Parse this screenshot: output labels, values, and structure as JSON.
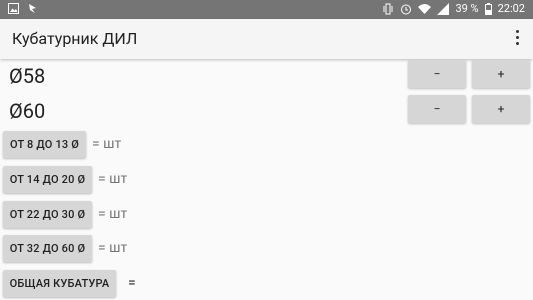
{
  "status_bar": {
    "battery": "39 %",
    "time": "22:02"
  },
  "app_bar": {
    "title": "Кубатурник ДИЛ"
  },
  "rows": [
    {
      "label": "Ø58",
      "minus": "−",
      "plus": "+"
    },
    {
      "label": "Ø60",
      "minus": "−",
      "plus": "+"
    }
  ],
  "categories": [
    {
      "label": "ОТ 8 ДО 13 Ø",
      "result": "= шт"
    },
    {
      "label": "ОТ 14 ДО 20 Ø",
      "result": "= шт"
    },
    {
      "label": "ОТ 22 ДО 30 Ø",
      "result": "= шт"
    },
    {
      "label": "ОТ 32 ДО 60 Ø",
      "result": "= шт"
    }
  ],
  "total": {
    "label": "ОБЩАЯ КУБАТУРА",
    "result": "="
  }
}
